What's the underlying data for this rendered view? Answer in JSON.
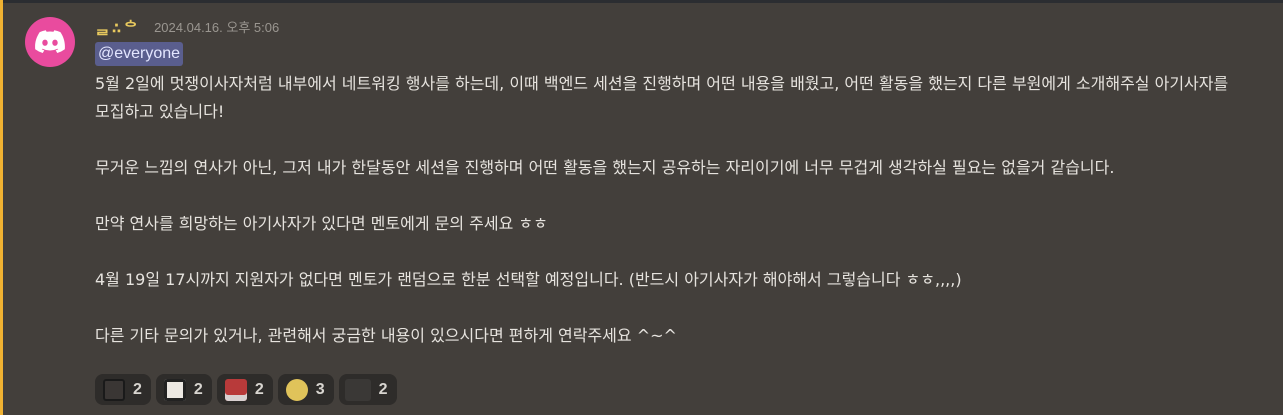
{
  "message": {
    "author": "ᆯ∴ᅌ",
    "timestamp": "2024.04.16. 오후 5:06",
    "mention": "@everyone",
    "paragraphs": [
      "5월 2일에 멋쟁이사자처럼 내부에서 네트워킹 행사를 하는데, 이때 백엔드 세션을 진행하며 어떤 내용을 배웠고, 어떤 활동을 했는지 다른 부원에게 소개해주실 아기사자를 모집하고 있습니다!",
      "무거운 느낌의 연사가 아닌, 그저 내가 한달동안 세션을 진행하며 어떤 활동을 했는지 공유하는 자리이기에 너무 무겁게 생각하실 필요는 없을거 같습니다.",
      "만약 연사를 희망하는 아기사자가 있다면 멘토에게 문의 주세요 ㅎㅎ",
      "4월 19일 17시까지 지원자가 없다면 멘토가 랜덤으로 한분 선택할 예정입니다. (반드시 아기사자가 해야해서 그렇습니다 ㅎㅎ,,,,)",
      "다른 기타 문의가 있거나, 관련해서 궁금한 내용이 있으시다면 편하게 연락주세요 ^~^"
    ]
  },
  "reactions": [
    {
      "icon": "character-emoji-icon",
      "count": "2",
      "color": "#3a3634"
    },
    {
      "icon": "speech-sticker-emoji-icon",
      "count": "2",
      "color": "#ece8e2"
    },
    {
      "icon": "red-sticker-emoji-icon",
      "count": "2",
      "color": "#b83a3a"
    },
    {
      "icon": "face-emoji-icon",
      "count": "3",
      "color": "#e0c35a"
    },
    {
      "icon": "custom-emoji-icon",
      "count": "2",
      "color": "#3a3836"
    }
  ],
  "colors": {
    "accent_mention": "#5a5e8e",
    "highlight_bar": "#f0b232",
    "avatar_bg": "#e94b9e",
    "message_bg": "#433f3b"
  }
}
